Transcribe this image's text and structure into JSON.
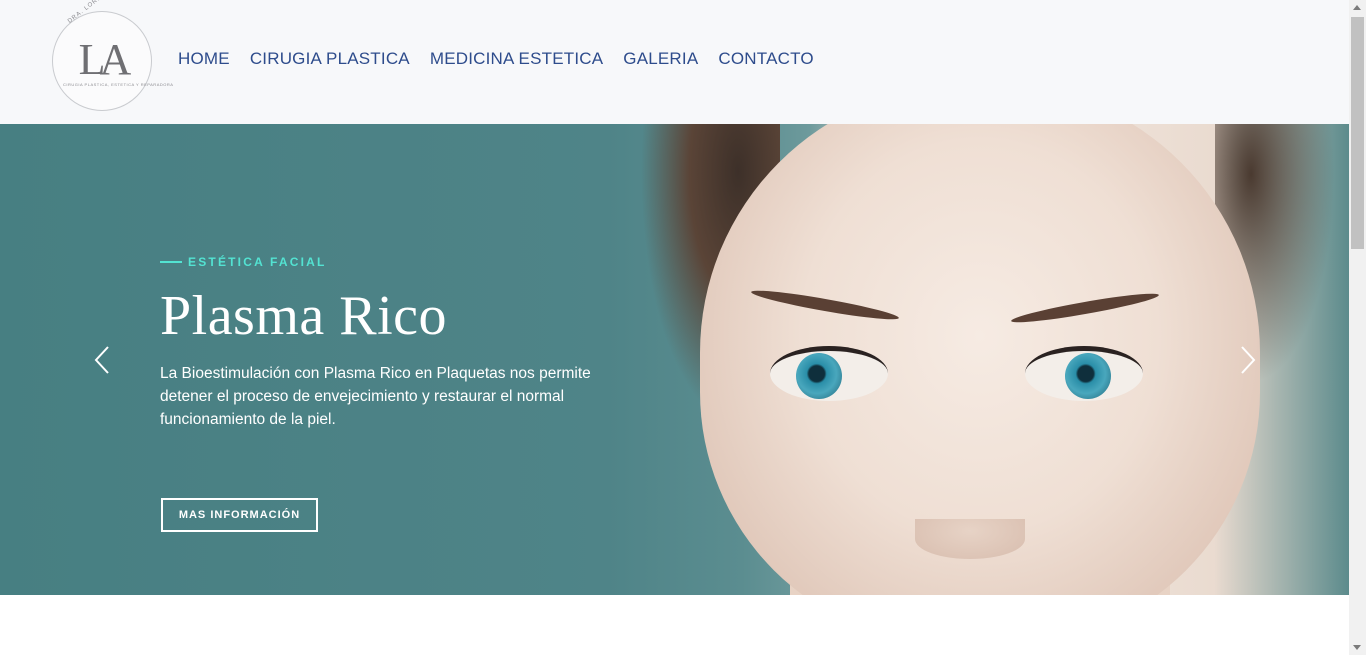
{
  "logo": {
    "monogram": "LA",
    "arc_text": "DRA. LORENA AGUILAR",
    "subtitle": "CIRUGIA PLASTICA, ESTETICA Y REPARADORA"
  },
  "nav": {
    "items": [
      {
        "label": "HOME"
      },
      {
        "label": "CIRUGIA PLASTICA"
      },
      {
        "label": "MEDICINA ESTETICA"
      },
      {
        "label": "GALERIA"
      },
      {
        "label": "CONTACTO"
      }
    ]
  },
  "hero": {
    "eyebrow": "ESTÉTICA FACIAL",
    "title": "Plasma Rico",
    "description": "La Bioestimulación con Plasma Rico en Plaquetas nos permite detener el proceso de envejecimiento y restaurar el normal funcionamiento de la piel.",
    "cta_label": "MAS INFORMACIÓN",
    "prev_icon": "chevron-left-icon",
    "next_icon": "chevron-right-icon"
  },
  "colors": {
    "nav_text": "#2e4c8c",
    "accent": "#53e3d2",
    "hero_bg": "#4f8488"
  }
}
